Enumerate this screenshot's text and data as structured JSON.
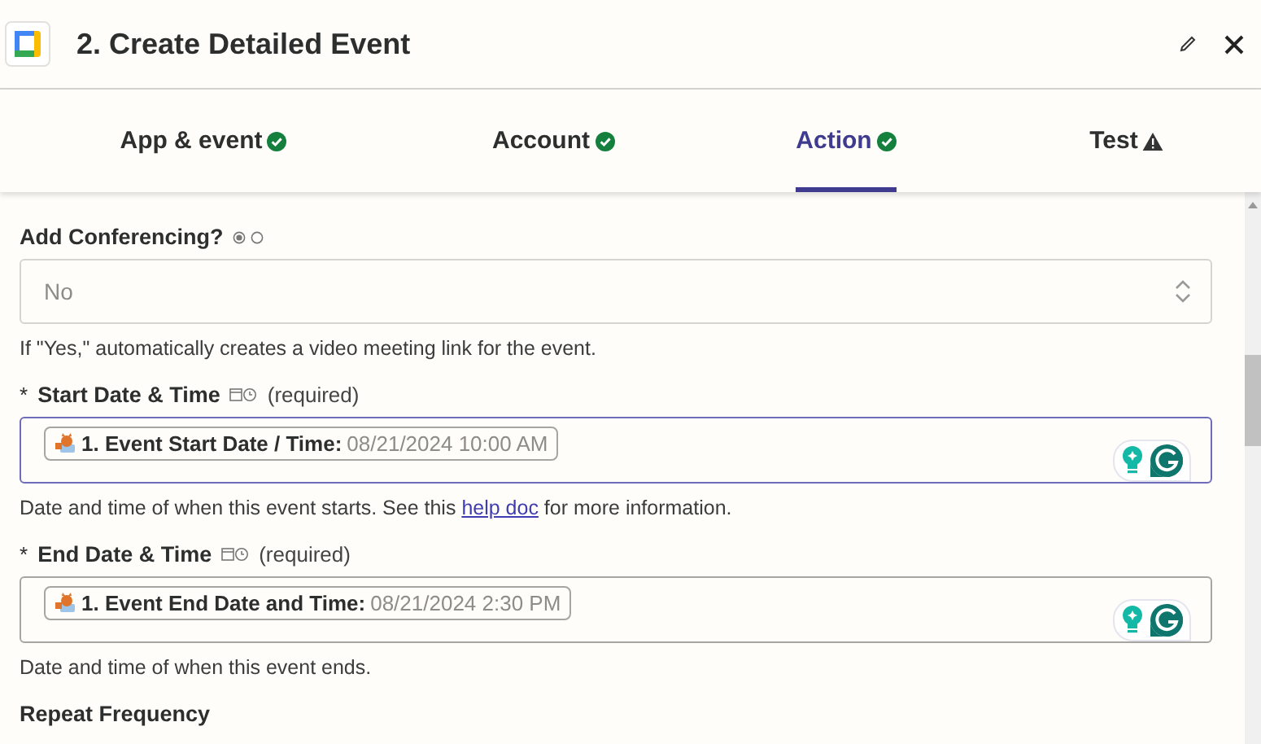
{
  "header": {
    "title": "2. Create Detailed Event"
  },
  "tabs": [
    {
      "label": "App & event",
      "complete": true,
      "selected": false
    },
    {
      "label": "Account",
      "complete": true,
      "selected": false
    },
    {
      "label": "Action",
      "complete": true,
      "selected": true
    },
    {
      "label": "Test",
      "complete": false,
      "selected": false
    }
  ],
  "fields": [
    {
      "kind": "select",
      "label": "Add Conferencing?",
      "value": "No",
      "hint": "If \"Yes,\" automatically creates a video meeting link for the event."
    },
    {
      "kind": "datetime",
      "label": "Start Date & Time",
      "required_mark": "*",
      "required_note": "(required)",
      "focused": true,
      "pill_label": "1. Event Start Date / Time:",
      "pill_value": "08/21/2024 10:00 AM",
      "hint": "Date and time of when this event starts. See this",
      "hint_link": "help doc",
      "hint_after": "for more information."
    },
    {
      "kind": "datetime",
      "label": "End Date & Time",
      "required_mark": "*",
      "required_note": "(required)",
      "focused": false,
      "pill_label": "1. Event End Date and Time:",
      "pill_value": "08/21/2024 2:30 PM",
      "hint": "Date and time of when this event ends."
    },
    {
      "kind": "heading",
      "label": "Repeat Frequency"
    }
  ]
}
